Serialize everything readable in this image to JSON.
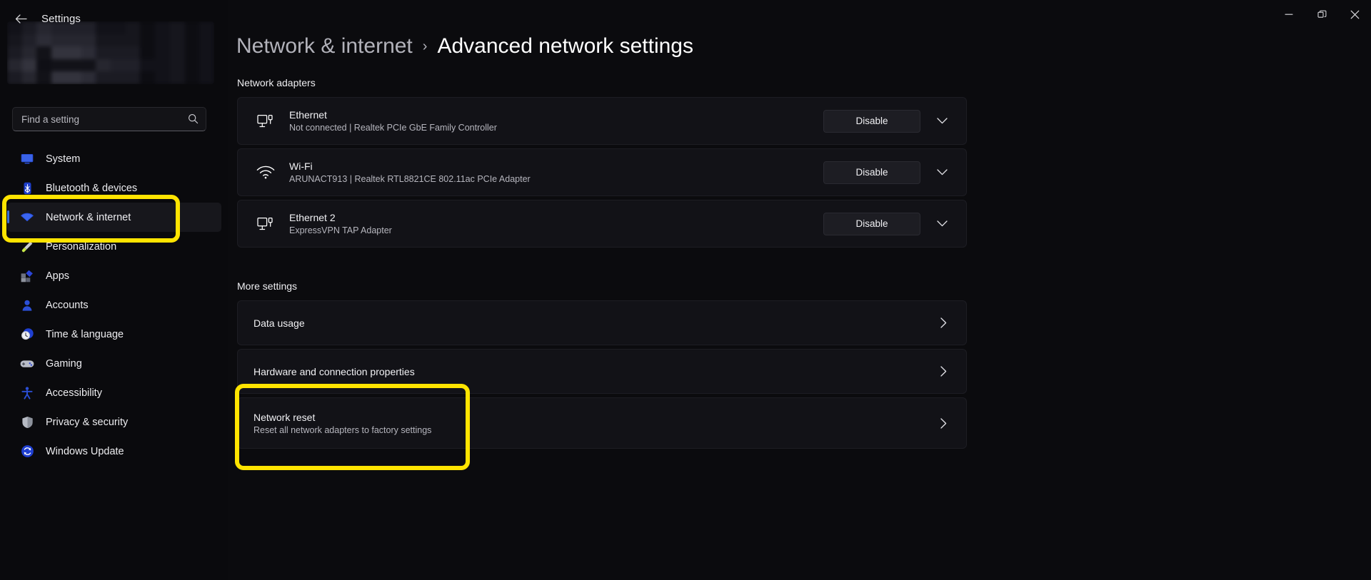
{
  "window": {
    "title": "Settings",
    "back_label": "Back",
    "controls": {
      "minimize": "Minimize",
      "maximize": "Restore",
      "close": "Close"
    }
  },
  "colors": {
    "accent": "#3a6fd8",
    "highlight": "#ffe400",
    "card_bg": "#121217",
    "page_bg": "#0b0b0e"
  },
  "sidebar": {
    "search": {
      "placeholder": "Find a setting",
      "value": "",
      "icon": "search-icon"
    },
    "items": [
      {
        "label": "System",
        "icon": "monitor-icon",
        "active": false
      },
      {
        "label": "Bluetooth & devices",
        "icon": "bluetooth-icon",
        "active": false
      },
      {
        "label": "Network & internet",
        "icon": "wifi-icon",
        "active": true
      },
      {
        "label": "Personalization",
        "icon": "brush-icon",
        "active": false
      },
      {
        "label": "Apps",
        "icon": "apps-icon",
        "active": false
      },
      {
        "label": "Accounts",
        "icon": "person-icon",
        "active": false
      },
      {
        "label": "Time & language",
        "icon": "clock-icon",
        "active": false
      },
      {
        "label": "Gaming",
        "icon": "gamepad-icon",
        "active": false
      },
      {
        "label": "Accessibility",
        "icon": "accessibility-icon",
        "active": false
      },
      {
        "label": "Privacy & security",
        "icon": "shield-icon",
        "active": false
      },
      {
        "label": "Windows Update",
        "icon": "update-icon",
        "active": false
      }
    ]
  },
  "breadcrumb": {
    "parent": "Network & internet",
    "separator": "›",
    "current": "Advanced network settings"
  },
  "sections": {
    "adapters": {
      "heading": "Network adapters",
      "rows": [
        {
          "name": "Ethernet",
          "sub": "Not connected | Realtek PCIe GbE Family Controller",
          "icon": "ethernet-icon",
          "button": "Disable",
          "expander": "chevron-down-icon"
        },
        {
          "name": "Wi-Fi",
          "sub": "ARUNACT913 | Realtek RTL8821CE 802.11ac PCIe Adapter",
          "icon": "wifi-icon",
          "button": "Disable",
          "expander": "chevron-down-icon"
        },
        {
          "name": "Ethernet 2",
          "sub": "ExpressVPN TAP Adapter",
          "icon": "ethernet-icon",
          "button": "Disable",
          "expander": "chevron-down-icon"
        }
      ]
    },
    "more": {
      "heading": "More settings",
      "rows": [
        {
          "title": "Data usage",
          "sub": "",
          "chevron": "chevron-right-icon"
        },
        {
          "title": "Hardware and connection properties",
          "sub": "",
          "chevron": "chevron-right-icon"
        },
        {
          "title": "Network reset",
          "sub": "Reset all network adapters to factory settings",
          "chevron": "chevron-right-icon"
        }
      ]
    }
  },
  "annotations": [
    {
      "target": "sidebar-item-network-internet",
      "color": "#ffe400"
    },
    {
      "target": "more-settings-row-network-reset",
      "color": "#ffe400"
    }
  ]
}
